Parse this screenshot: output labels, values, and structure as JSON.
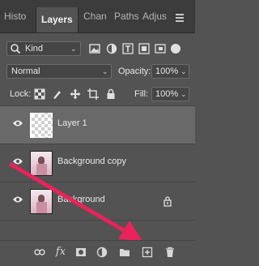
{
  "tabs": [
    {
      "label": "Histo"
    },
    {
      "label": "Layers"
    },
    {
      "label": "Chan"
    },
    {
      "label": "Paths"
    },
    {
      "label": "Adjus"
    }
  ],
  "filter": {
    "kind_label": "Kind"
  },
  "blend": {
    "mode": "Normal",
    "opacity_label": "Opacity:",
    "opacity_value": "100%"
  },
  "lock": {
    "label": "Lock:",
    "fill_label": "Fill:",
    "fill_value": "100%"
  },
  "layers": [
    {
      "name": "Layer 1"
    },
    {
      "name": "Background copy"
    },
    {
      "name": "Background"
    }
  ],
  "colors": {
    "panel": "#535353",
    "selected": "#696969",
    "arrow": "#e8245a"
  }
}
